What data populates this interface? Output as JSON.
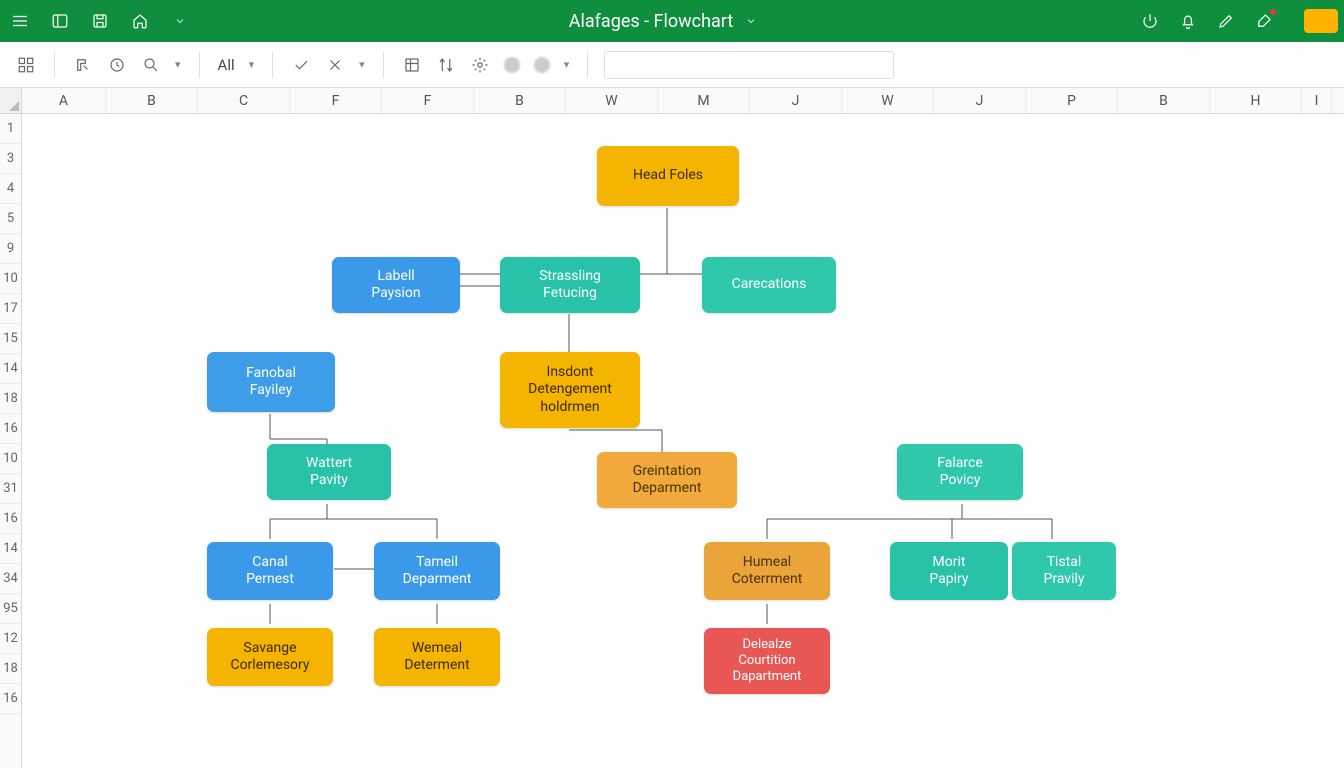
{
  "titlebar": {
    "title": "Alafages - Flowchart"
  },
  "toolbar": {
    "filter_label": "All"
  },
  "columns": [
    "A",
    "B",
    "C",
    "F",
    "F",
    "B",
    "W",
    "M",
    "J",
    "W",
    "J",
    "P",
    "B",
    "H",
    "I"
  ],
  "rows": [
    "1",
    "3",
    "4",
    "5",
    "9",
    "10",
    "17",
    "15",
    "14",
    "18",
    "16",
    "10",
    "31",
    "16",
    "14",
    "34",
    "95",
    "12",
    "18",
    "16"
  ],
  "nodes": {
    "head": {
      "l1": "Head Foles"
    },
    "labell": {
      "l1": "Labell",
      "l2": "Paysion"
    },
    "strassling": {
      "l1": "Strassling",
      "l2": "Fetucing"
    },
    "carecations": {
      "l1": "Carecations"
    },
    "fanobal": {
      "l1": "Fanobal",
      "l2": "Fayiley"
    },
    "insdont": {
      "l1": "Insdont",
      "l2": "Detengement",
      "l3": "holdrmen"
    },
    "wattert": {
      "l1": "Wattert",
      "l2": "Pavity"
    },
    "greintation": {
      "l1": "Greintation",
      "l2": "Deparment"
    },
    "falarce": {
      "l1": "Falarce",
      "l2": "Povicy"
    },
    "canal": {
      "l1": "Canal",
      "l2": "Pernest"
    },
    "tameil": {
      "l1": "Tameil",
      "l2": "Deparment"
    },
    "humeal": {
      "l1": "Humeal",
      "l2": "Coterrment"
    },
    "morit": {
      "l1": "Morit",
      "l2": "Papiry"
    },
    "tistal": {
      "l1": "Tistal",
      "l2": "Pravily"
    },
    "savange": {
      "l1": "Savange",
      "l2": "Corlemesory"
    },
    "wemeal": {
      "l1": "Wemeal",
      "l2": "Determent"
    },
    "delealze": {
      "l1": "Delealze",
      "l2": "Courtition",
      "l3": "Dapartment"
    }
  }
}
